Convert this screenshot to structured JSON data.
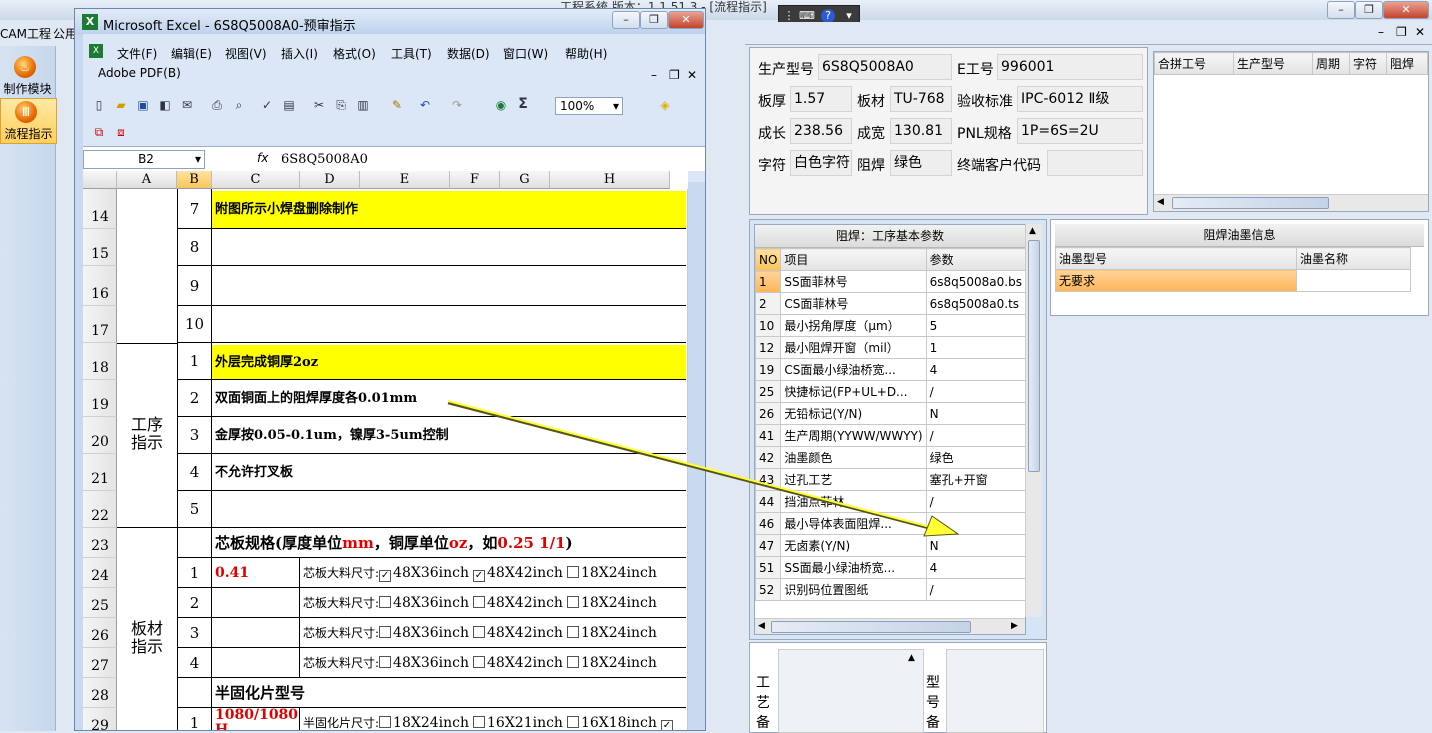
{
  "app": {
    "title": "工程系统   版本：1.1.51.3 - [流程指示]",
    "menu": [
      "CAM工程",
      "公用"
    ],
    "side_items": [
      {
        "label": "制作模块"
      },
      {
        "label": "流程指示"
      }
    ]
  },
  "excel": {
    "title": "Microsoft Excel - 6S8Q5008A0-预审指示",
    "menu": [
      "文件(F)",
      "编辑(E)",
      "视图(V)",
      "插入(I)",
      "格式(O)",
      "工具(T)",
      "数据(D)",
      "窗口(W)",
      "帮助(H)"
    ],
    "menu2": "Adobe PDF(B)",
    "zoom": "100%",
    "name_box": "B2",
    "fx": "fx",
    "formula_value": "6S8Q5008A0",
    "columns": [
      "A",
      "B",
      "C",
      "D",
      "E",
      "F",
      "G",
      "H"
    ],
    "rows": [
      {
        "num": "14",
        "b": "7",
        "text": "附图所示小焊盘删除制作"
      },
      {
        "num": "15",
        "b": "8",
        "text": ""
      },
      {
        "num": "16",
        "b": "9",
        "text": ""
      },
      {
        "num": "17",
        "b": "10",
        "text": ""
      },
      {
        "num": "18",
        "b": "1",
        "text": "外层完成铜厚2oz"
      },
      {
        "num": "19",
        "b": "2",
        "text": "双面铜面上的阻焊厚度各0.01mm"
      },
      {
        "num": "20",
        "b": "3",
        "text": "金厚按0.05-0.1um，镍厚3-5um控制"
      },
      {
        "num": "21",
        "b": "4",
        "text": "不允许打叉板"
      },
      {
        "num": "22",
        "b": "5",
        "text": ""
      },
      {
        "num": "23"
      },
      {
        "num": "24"
      },
      {
        "num": "25"
      },
      {
        "num": "26"
      },
      {
        "num": "27"
      },
      {
        "num": "28"
      },
      {
        "num": "29"
      }
    ],
    "group_process": "工序\n指示",
    "group_material": "板材\n指示",
    "core_spec": {
      "a": "芯板规格(厚度单位",
      "b": "mm",
      "c": "，铜厚单位",
      "d": "oz",
      "e": "，如",
      "f": "0.25 1/1",
      "g": ")"
    },
    "core_rows": [
      {
        "b": "1",
        "c": "0.41",
        "label": "芯板大料尺寸:",
        "o1": "48X36inch",
        "o2": "48X42inch",
        "o3": "18X24inch",
        "c1": "✓",
        "c2": "✓",
        "c3": ""
      },
      {
        "b": "2",
        "c": "",
        "label": "芯板大料尺寸:",
        "o1": "48X36inch",
        "o2": "48X42inch",
        "o3": "18X24inch",
        "c1": "",
        "c2": "",
        "c3": ""
      },
      {
        "b": "3",
        "c": "",
        "label": "芯板大料尺寸:",
        "o1": "48X36inch",
        "o2": "48X42inch",
        "o3": "18X24inch",
        "c1": "",
        "c2": "",
        "c3": ""
      },
      {
        "b": "4",
        "c": "",
        "label": "芯板大料尺寸:",
        "o1": "48X36inch",
        "o2": "48X42inch",
        "o3": "18X24inch",
        "c1": "",
        "c2": "",
        "c3": ""
      }
    ],
    "prepreg_title": "半固化片型号",
    "prepreg_row": {
      "b": "1",
      "c": "1080/1080",
      "c2": "H",
      "label": "半固化片尺寸:",
      "o1": "18X24inch",
      "o2": "16X21inch",
      "o3": "16X18inch",
      "c4": "✓"
    }
  },
  "info": {
    "fields": [
      {
        "label": "生产型号",
        "value": "6S8Q5008A0"
      },
      {
        "label": "E工号",
        "value": "996001"
      },
      {
        "label": "板厚",
        "value": "1.57"
      },
      {
        "label": "板材",
        "value": "TU-768"
      },
      {
        "label": "验收标准",
        "value": "IPC-6012 Ⅱ级"
      },
      {
        "label": "成长",
        "value": "238.56"
      },
      {
        "label": "成宽",
        "value": "130.81"
      },
      {
        "label": "PNL规格",
        "value": "1P=6S=2U"
      },
      {
        "label": "字符",
        "value": "白色字符"
      },
      {
        "label": "阻焊",
        "value": "绿色"
      },
      {
        "label": "终端客户代码",
        "value": ""
      }
    ],
    "merge_headers": [
      "合拼工号",
      "生产型号",
      "周期",
      "字符",
      "阻焊"
    ]
  },
  "params": {
    "title": "阻焊：工序基本参数",
    "headers": [
      "NO",
      "项目",
      "参数"
    ],
    "rows": [
      [
        "1",
        "SS面菲林号",
        "6s8q5008a0.bs"
      ],
      [
        "2",
        "CS面菲林号",
        "6s8q5008a0.ts"
      ],
      [
        "10",
        "最小拐角厚度（μm）",
        "5"
      ],
      [
        "12",
        "最小阻焊开窗（mil）",
        "1"
      ],
      [
        "19",
        "CS面最小绿油桥宽...",
        "4"
      ],
      [
        "25",
        "快捷标记(FP+UL+D...",
        "/"
      ],
      [
        "26",
        "无铅标记(Y/N)",
        "N"
      ],
      [
        "41",
        "生产周期(YYWW/WWYY)",
        "/"
      ],
      [
        "42",
        "油墨颜色",
        "绿色"
      ],
      [
        "43",
        "过孔工艺",
        "塞孔+开窗"
      ],
      [
        "44",
        "挡油点菲林",
        "/"
      ],
      [
        "46",
        "最小导体表面阻焊...",
        "/"
      ],
      [
        "47",
        "无卤素(Y/N)",
        "N"
      ],
      [
        "51",
        "SS面最小绿油桥宽...",
        "4"
      ],
      [
        "52",
        "识别码位置图纸",
        "/"
      ]
    ]
  },
  "ink": {
    "title": "阻焊油墨信息",
    "headers": [
      "油墨型号",
      "油墨名称"
    ],
    "rows": [
      [
        "无要求",
        ""
      ]
    ]
  },
  "bottom": {
    "label1": "工\n艺\n备",
    "label2": "型\n号\n备"
  },
  "colors": {
    "highlight": "#ffff00",
    "accent_red": "#e00000",
    "arrow": "#ffff33",
    "selected_row": "#ffc06a"
  }
}
